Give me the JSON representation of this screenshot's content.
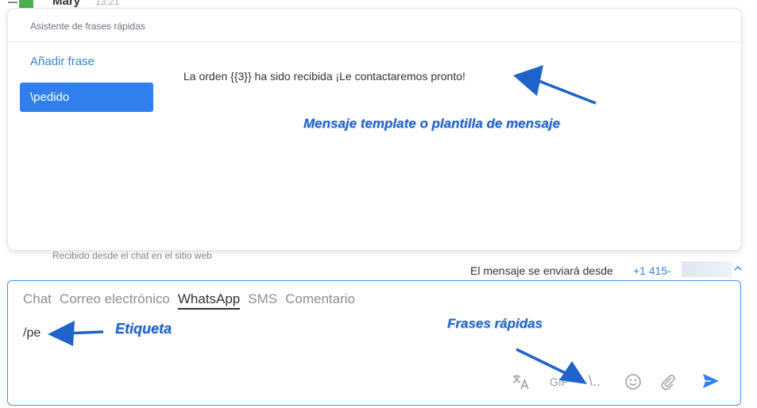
{
  "chat": {
    "sender_name": "Mary",
    "sender_time": "13:21",
    "received_note": "Recibido desde el chat en el sitio web",
    "send_from_label": "El mensaje se enviará desde",
    "send_from_phone": "+1 415-"
  },
  "quick_phrases": {
    "title": "Asistente de frases rápidas",
    "add_label": "Añadir frase",
    "items": [
      {
        "label": "\\pedido",
        "selected": true
      }
    ],
    "preview": "La orden {{3}} ha sido recibida ¡Le contactaremos pronto!"
  },
  "annotations": {
    "template": "Mensaje template o plantilla de mensaje",
    "etiqueta": "Etiqueta",
    "frases": "Frases rápidas",
    "color": "#1f63c8"
  },
  "composer": {
    "tabs": [
      {
        "label": "Chat",
        "active": false
      },
      {
        "label": "Correo electrónico",
        "active": false
      },
      {
        "label": "WhatsApp",
        "active": true
      },
      {
        "label": "SMS",
        "active": false
      },
      {
        "label": "Comentario",
        "active": false
      }
    ],
    "text": "/pe",
    "tools": {
      "translate_icon": "translate-icon",
      "gif_label": "GIF",
      "quick_phrase_label": "\\..",
      "emoji_icon": "emoji-icon",
      "attach_icon": "paperclip-icon",
      "send_icon": "send-icon"
    }
  },
  "colors": {
    "accent": "#2f80ed",
    "link": "#3b82d6",
    "composer_border": "#4a90e2"
  }
}
